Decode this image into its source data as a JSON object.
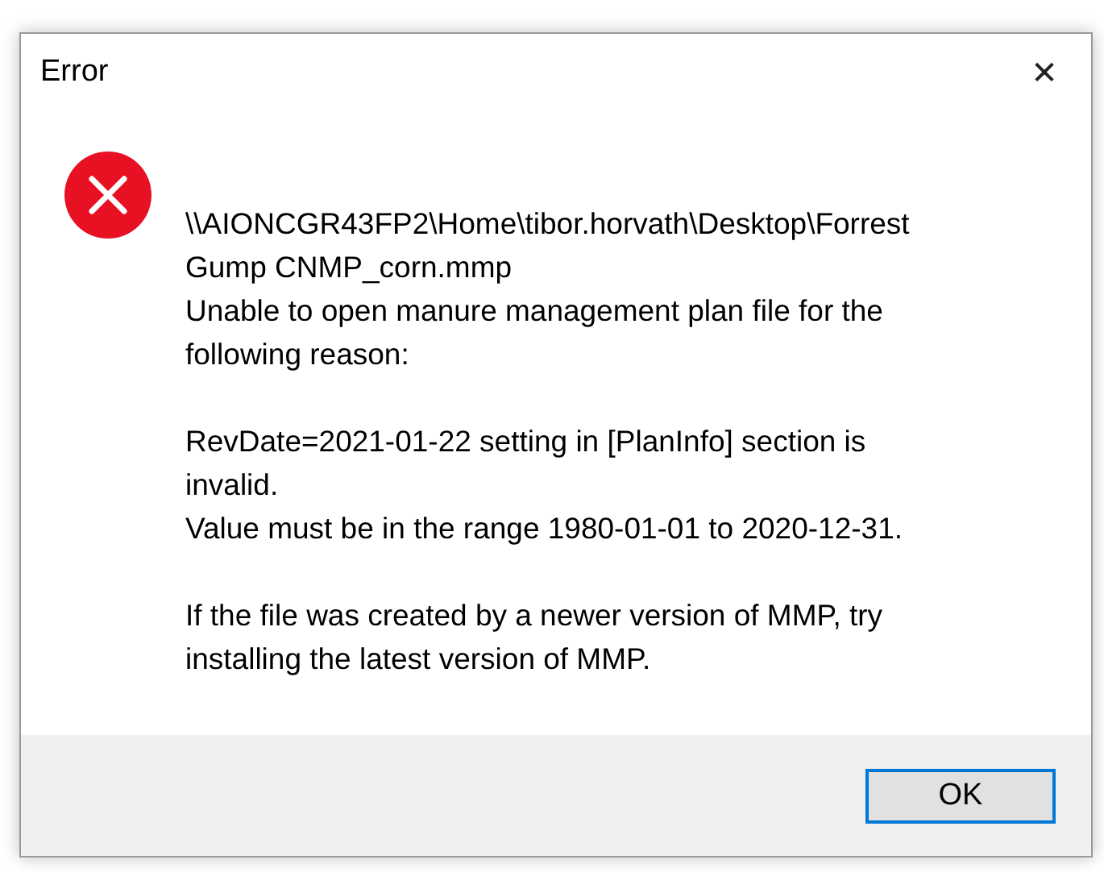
{
  "window": {
    "title": "Error",
    "close": "✕"
  },
  "message": {
    "paragraphs": [
      [
        "\\\\AIONCGR43FP2\\Home\\tibor.horvath\\Desktop\\Forrest",
        "Gump CNMP_corn.mmp",
        "Unable to open manure management plan file for the",
        "following reason:"
      ],
      [
        "RevDate=2021-01-22 setting in [PlanInfo] section is",
        "invalid.",
        "Value must be in the range 1980-01-01 to 2020-12-31."
      ],
      [
        "If the file was created by a newer version of MMP, try",
        "installing the latest version of MMP."
      ]
    ]
  },
  "buttons": [
    {
      "label": "OK",
      "selected": true
    }
  ]
}
